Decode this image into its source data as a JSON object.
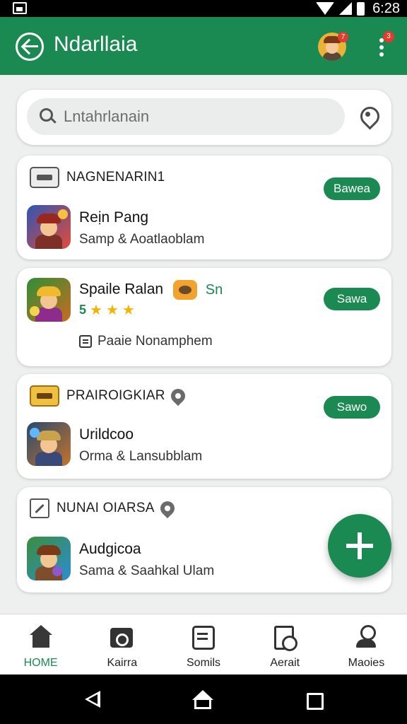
{
  "status_bar": {
    "time": "6:28"
  },
  "app_bar": {
    "title": "Ndarllaia",
    "notification_count": "7",
    "menu_badge": "3"
  },
  "search": {
    "placeholder": "Lntahrlanain"
  },
  "cards": [
    {
      "header": "NAGNENARIN1",
      "status": "Bawea",
      "title": "Reịn Pang",
      "subtitle": "Samp & Aoatlaoblam"
    },
    {
      "header": "",
      "status": "Sawa",
      "title": "Spaile Ralan",
      "tag": "Sn",
      "rating_score": "5",
      "rating_stars": 3,
      "doc_text": "Paaie Nonamphem"
    },
    {
      "header": "PRAIROIGKIAR",
      "status": "Sawo",
      "title": "Urildcoo",
      "subtitle": "Orma & Lansubblam"
    },
    {
      "header": "NUNAI OIARSA",
      "title": "Audgicoa",
      "subtitle": "Sama & Saahkal Ulam"
    }
  ],
  "nav": [
    {
      "label": "HOME",
      "icon": "home-icon",
      "active": true
    },
    {
      "label": "Kairra",
      "icon": "camera-icon"
    },
    {
      "label": "Somils",
      "icon": "list-icon"
    },
    {
      "label": "Aerait",
      "icon": "report-icon"
    },
    {
      "label": "Maoies",
      "icon": "person-icon"
    }
  ],
  "colors": {
    "primary": "#1b8a52",
    "badge": "#e23b30",
    "star": "#f2b600"
  }
}
